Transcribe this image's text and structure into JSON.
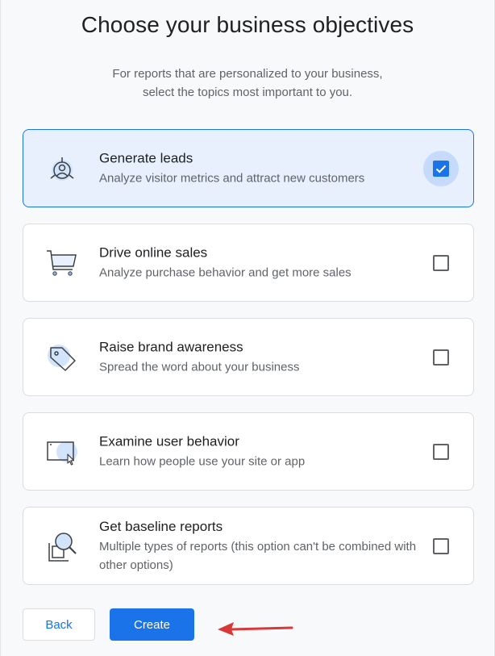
{
  "page": {
    "title": "Choose your business objectives",
    "subtitle_line1": "For reports that are personalized to your business,",
    "subtitle_line2": "select the topics most important to you."
  },
  "objectives": [
    {
      "name": "Generate leads",
      "description": "Analyze visitor metrics and attract new customers",
      "icon": "leads-person-icon",
      "checked": true
    },
    {
      "name": "Drive online sales",
      "description": "Analyze purchase behavior and get more sales",
      "icon": "shopping-cart-icon",
      "checked": false
    },
    {
      "name": "Raise brand awareness",
      "description": "Spread the word about your business",
      "icon": "tag-icon",
      "checked": false
    },
    {
      "name": "Examine user behavior",
      "description": "Learn how people use your site or app",
      "icon": "browser-cursor-icon",
      "checked": false
    },
    {
      "name": "Get baseline reports",
      "description": "Multiple types of reports (this option can't be combined with other options)",
      "icon": "magnifier-report-icon",
      "checked": false
    }
  ],
  "actions": {
    "back_label": "Back",
    "create_label": "Create"
  },
  "colors": {
    "accent": "#1a73e8",
    "selected_bg": "#e8f0fe",
    "annotation_arrow": "#d9383a"
  }
}
